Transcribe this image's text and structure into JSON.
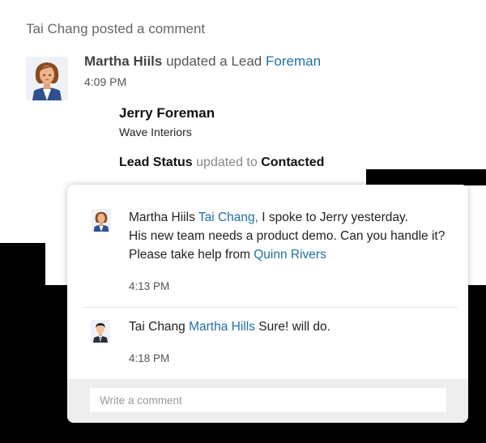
{
  "header": {
    "text": "Tai Chang posted a comment"
  },
  "activity": {
    "actor": "Martha Hiils",
    "action": "updated a Lead",
    "lead_link": "Foreman",
    "time": "4:09 PM",
    "lead_name": "Jerry Foreman",
    "company": "Wave Interiors",
    "field": "Lead Status",
    "verb": "updated to",
    "new_value": "Contacted"
  },
  "comments": [
    {
      "author": "Martha Hiils",
      "mention": "Tai Chang,",
      "text_1": "I spoke to Jerry yesterday.",
      "text_2": "His new team needs a product demo. Can you handle it?",
      "text_3": "Please take help from",
      "mention_2": "Quinn Rivers",
      "time": "4:13 PM"
    },
    {
      "author": "Tai Chang",
      "mention": "Martha Hills",
      "text": "Sure! will do.",
      "time": "4:18 PM"
    }
  ],
  "input": {
    "placeholder": "Write a comment"
  },
  "colors": {
    "link": "#1f6fa6",
    "overlay_bg": "#000000"
  },
  "icons": {
    "activity_avatar": "woman-avatar-icon",
    "comment_1_avatar": "woman-avatar-icon",
    "comment_2_avatar": "man-avatar-icon"
  }
}
